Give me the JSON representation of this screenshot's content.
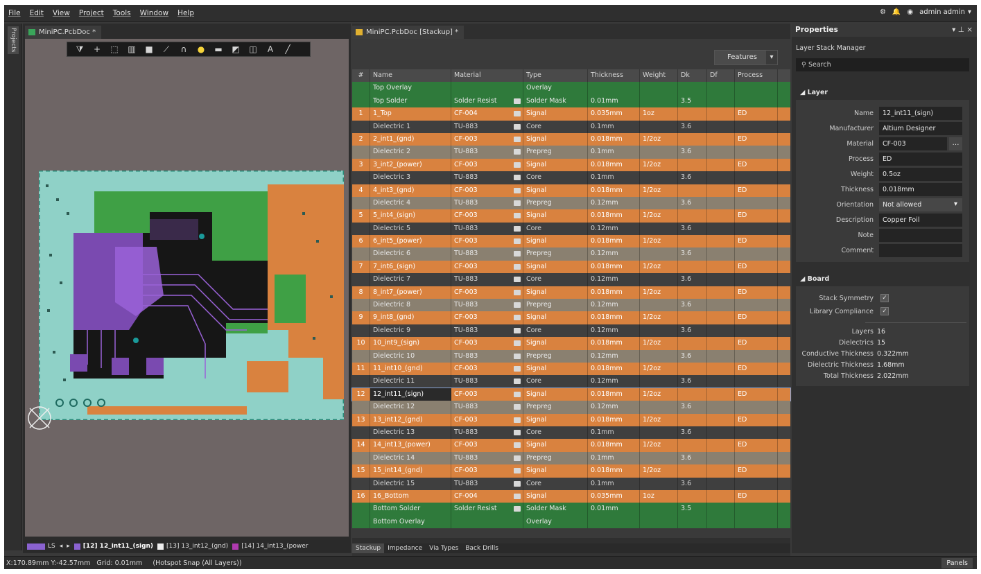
{
  "menu": [
    "File",
    "Edit",
    "View",
    "Project",
    "Tools",
    "Window",
    "Help"
  ],
  "user": {
    "name": "admin admin"
  },
  "side_tab": "Projects",
  "pcb_tab": {
    "title": "MiniPC.PcbDoc *"
  },
  "stack_tab": {
    "title": "MiniPC.PcbDoc [Stackup] *"
  },
  "features_label": "Features",
  "columns": [
    "#",
    "Name",
    "Material",
    "Type",
    "Thickness",
    "Weight",
    "Dk",
    "Df",
    "Process"
  ],
  "layers": [
    {
      "num": "",
      "name": "Top Overlay",
      "material": "",
      "type": "Overlay",
      "thickness": "",
      "weight": "",
      "dk": "",
      "process": "",
      "kind": "overlay"
    },
    {
      "num": "",
      "name": "Top Solder",
      "material": "Solder Resist",
      "type": "Solder Mask",
      "thickness": "0.01mm",
      "weight": "",
      "dk": "3.5",
      "process": "",
      "kind": "solder"
    },
    {
      "num": "1",
      "name": "1_Top",
      "material": "CF-004",
      "type": "Signal",
      "thickness": "0.035mm",
      "weight": "1oz",
      "dk": "",
      "process": "ED",
      "kind": "signal"
    },
    {
      "num": "",
      "name": "Dielectric 1",
      "material": "TU-883",
      "type": "Core",
      "thickness": "0.1mm",
      "weight": "",
      "dk": "3.6",
      "process": "",
      "kind": "core"
    },
    {
      "num": "2",
      "name": "2_int1_(gnd)",
      "material": "CF-003",
      "type": "Signal",
      "thickness": "0.018mm",
      "weight": "1/2oz",
      "dk": "",
      "process": "ED",
      "kind": "signal"
    },
    {
      "num": "",
      "name": "Dielectric 2",
      "material": "TU-883",
      "type": "Prepreg",
      "thickness": "0.1mm",
      "weight": "",
      "dk": "3.6",
      "process": "",
      "kind": "prepreg"
    },
    {
      "num": "3",
      "name": "3_int2_(power)",
      "material": "CF-003",
      "type": "Signal",
      "thickness": "0.018mm",
      "weight": "1/2oz",
      "dk": "",
      "process": "ED",
      "kind": "signal"
    },
    {
      "num": "",
      "name": "Dielectric 3",
      "material": "TU-883",
      "type": "Core",
      "thickness": "0.1mm",
      "weight": "",
      "dk": "3.6",
      "process": "",
      "kind": "core"
    },
    {
      "num": "4",
      "name": "4_int3_(gnd)",
      "material": "CF-003",
      "type": "Signal",
      "thickness": "0.018mm",
      "weight": "1/2oz",
      "dk": "",
      "process": "ED",
      "kind": "signal"
    },
    {
      "num": "",
      "name": "Dielectric 4",
      "material": "TU-883",
      "type": "Prepreg",
      "thickness": "0.12mm",
      "weight": "",
      "dk": "3.6",
      "process": "",
      "kind": "prepreg"
    },
    {
      "num": "5",
      "name": "5_int4_(sign)",
      "material": "CF-003",
      "type": "Signal",
      "thickness": "0.018mm",
      "weight": "1/2oz",
      "dk": "",
      "process": "ED",
      "kind": "signal"
    },
    {
      "num": "",
      "name": "Dielectric 5",
      "material": "TU-883",
      "type": "Core",
      "thickness": "0.12mm",
      "weight": "",
      "dk": "3.6",
      "process": "",
      "kind": "core"
    },
    {
      "num": "6",
      "name": "6_int5_(power)",
      "material": "CF-003",
      "type": "Signal",
      "thickness": "0.018mm",
      "weight": "1/2oz",
      "dk": "",
      "process": "ED",
      "kind": "signal"
    },
    {
      "num": "",
      "name": "Dielectric 6",
      "material": "TU-883",
      "type": "Prepreg",
      "thickness": "0.12mm",
      "weight": "",
      "dk": "3.6",
      "process": "",
      "kind": "prepreg"
    },
    {
      "num": "7",
      "name": "7_int6_(sign)",
      "material": "CF-003",
      "type": "Signal",
      "thickness": "0.018mm",
      "weight": "1/2oz",
      "dk": "",
      "process": "ED",
      "kind": "signal"
    },
    {
      "num": "",
      "name": "Dielectric 7",
      "material": "TU-883",
      "type": "Core",
      "thickness": "0.12mm",
      "weight": "",
      "dk": "3.6",
      "process": "",
      "kind": "core"
    },
    {
      "num": "8",
      "name": "8_int7_(power)",
      "material": "CF-003",
      "type": "Signal",
      "thickness": "0.018mm",
      "weight": "1/2oz",
      "dk": "",
      "process": "ED",
      "kind": "signal"
    },
    {
      "num": "",
      "name": "Dielectric 8",
      "material": "TU-883",
      "type": "Prepreg",
      "thickness": "0.12mm",
      "weight": "",
      "dk": "3.6",
      "process": "",
      "kind": "prepreg"
    },
    {
      "num": "9",
      "name": "9_int8_(gnd)",
      "material": "CF-003",
      "type": "Signal",
      "thickness": "0.018mm",
      "weight": "1/2oz",
      "dk": "",
      "process": "ED",
      "kind": "signal"
    },
    {
      "num": "",
      "name": "Dielectric 9",
      "material": "TU-883",
      "type": "Core",
      "thickness": "0.12mm",
      "weight": "",
      "dk": "3.6",
      "process": "",
      "kind": "core"
    },
    {
      "num": "10",
      "name": "10_int9_(sign)",
      "material": "CF-003",
      "type": "Signal",
      "thickness": "0.018mm",
      "weight": "1/2oz",
      "dk": "",
      "process": "ED",
      "kind": "signal"
    },
    {
      "num": "",
      "name": "Dielectric 10",
      "material": "TU-883",
      "type": "Prepreg",
      "thickness": "0.12mm",
      "weight": "",
      "dk": "3.6",
      "process": "",
      "kind": "prepreg"
    },
    {
      "num": "11",
      "name": "11_int10_(gnd)",
      "material": "CF-003",
      "type": "Signal",
      "thickness": "0.018mm",
      "weight": "1/2oz",
      "dk": "",
      "process": "ED",
      "kind": "signal"
    },
    {
      "num": "",
      "name": "Dielectric 11",
      "material": "TU-883",
      "type": "Core",
      "thickness": "0.12mm",
      "weight": "",
      "dk": "3.6",
      "process": "",
      "kind": "core"
    },
    {
      "num": "12",
      "name": "12_int11_(sign)",
      "material": "CF-003",
      "type": "Signal",
      "thickness": "0.018mm",
      "weight": "1/2oz",
      "dk": "",
      "process": "ED",
      "kind": "signal",
      "selected": true
    },
    {
      "num": "",
      "name": "Dielectric 12",
      "material": "TU-883",
      "type": "Prepreg",
      "thickness": "0.12mm",
      "weight": "",
      "dk": "3.6",
      "process": "",
      "kind": "prepreg"
    },
    {
      "num": "13",
      "name": "13_int12_(gnd)",
      "material": "CF-003",
      "type": "Signal",
      "thickness": "0.018mm",
      "weight": "1/2oz",
      "dk": "",
      "process": "ED",
      "kind": "signal"
    },
    {
      "num": "",
      "name": "Dielectric 13",
      "material": "TU-883",
      "type": "Core",
      "thickness": "0.1mm",
      "weight": "",
      "dk": "3.6",
      "process": "",
      "kind": "core"
    },
    {
      "num": "14",
      "name": "14_int13_(power)",
      "material": "CF-003",
      "type": "Signal",
      "thickness": "0.018mm",
      "weight": "1/2oz",
      "dk": "",
      "process": "ED",
      "kind": "signal"
    },
    {
      "num": "",
      "name": "Dielectric 14",
      "material": "TU-883",
      "type": "Prepreg",
      "thickness": "0.1mm",
      "weight": "",
      "dk": "3.6",
      "process": "",
      "kind": "prepreg"
    },
    {
      "num": "15",
      "name": "15_int14_(gnd)",
      "material": "CF-003",
      "type": "Signal",
      "thickness": "0.018mm",
      "weight": "1/2oz",
      "dk": "",
      "process": "ED",
      "kind": "signal"
    },
    {
      "num": "",
      "name": "Dielectric 15",
      "material": "TU-883",
      "type": "Core",
      "thickness": "0.1mm",
      "weight": "",
      "dk": "3.6",
      "process": "",
      "kind": "core"
    },
    {
      "num": "16",
      "name": "16_Bottom",
      "material": "CF-004",
      "type": "Signal",
      "thickness": "0.035mm",
      "weight": "1oz",
      "dk": "",
      "process": "ED",
      "kind": "signal"
    },
    {
      "num": "",
      "name": "Bottom Solder",
      "material": "Solder Resist",
      "type": "Solder Mask",
      "thickness": "0.01mm",
      "weight": "",
      "dk": "3.5",
      "process": "",
      "kind": "solder"
    },
    {
      "num": "",
      "name": "Bottom Overlay",
      "material": "",
      "type": "Overlay",
      "thickness": "",
      "weight": "",
      "dk": "",
      "process": "",
      "kind": "overlay"
    }
  ],
  "bottom_tabs": [
    "Stackup",
    "Impedance",
    "Via Types",
    "Back Drills"
  ],
  "layer_tabs": {
    "ls": "LS",
    "l12": "[12] 12_int11_(sign)",
    "l13": "[13] 13_int12_(gnd)",
    "l14": "[14] 14_int13_(power"
  },
  "properties": {
    "title": "Properties",
    "subtitle": "Layer Stack Manager",
    "search_placeholder": "Search",
    "layer_section": "Layer",
    "layer_fields": [
      {
        "label": "Name",
        "value": "12_int11_(sign)"
      },
      {
        "label": "Manufacturer",
        "value": "Altium Designer"
      },
      {
        "label": "Material",
        "value": "CF-003"
      },
      {
        "label": "Process",
        "value": "ED"
      },
      {
        "label": "Weight",
        "value": "0.5oz"
      },
      {
        "label": "Thickness",
        "value": "0.018mm"
      },
      {
        "label": "Orientation",
        "value": "Not allowed"
      },
      {
        "label": "Description",
        "value": "Copper Foil"
      },
      {
        "label": "Note",
        "value": ""
      },
      {
        "label": "Comment",
        "value": ""
      }
    ],
    "board_section": "Board",
    "board_checks": [
      {
        "label": "Stack Symmetry",
        "checked": true
      },
      {
        "label": "Library Compliance",
        "checked": true
      }
    ],
    "board_stats": [
      {
        "label": "Layers",
        "value": "16"
      },
      {
        "label": "Dielectrics",
        "value": "15"
      },
      {
        "label": "Conductive Thickness",
        "value": "0.322mm"
      },
      {
        "label": "Dielectric Thickness",
        "value": "1.68mm"
      },
      {
        "label": "Total Thickness",
        "value": "2.022mm"
      }
    ]
  },
  "status": {
    "coords": "X:170.89mm Y:-42.57mm",
    "grid": "Grid: 0.01mm",
    "snap": "(Hotspot Snap (All Layers))",
    "panels": "Panels"
  },
  "colors": {
    "signal": "#d9823f",
    "solder": "#2f7a3b",
    "prepreg": "#8a8070",
    "core": "#3f3f3f",
    "accent": "#8aa4d6"
  }
}
